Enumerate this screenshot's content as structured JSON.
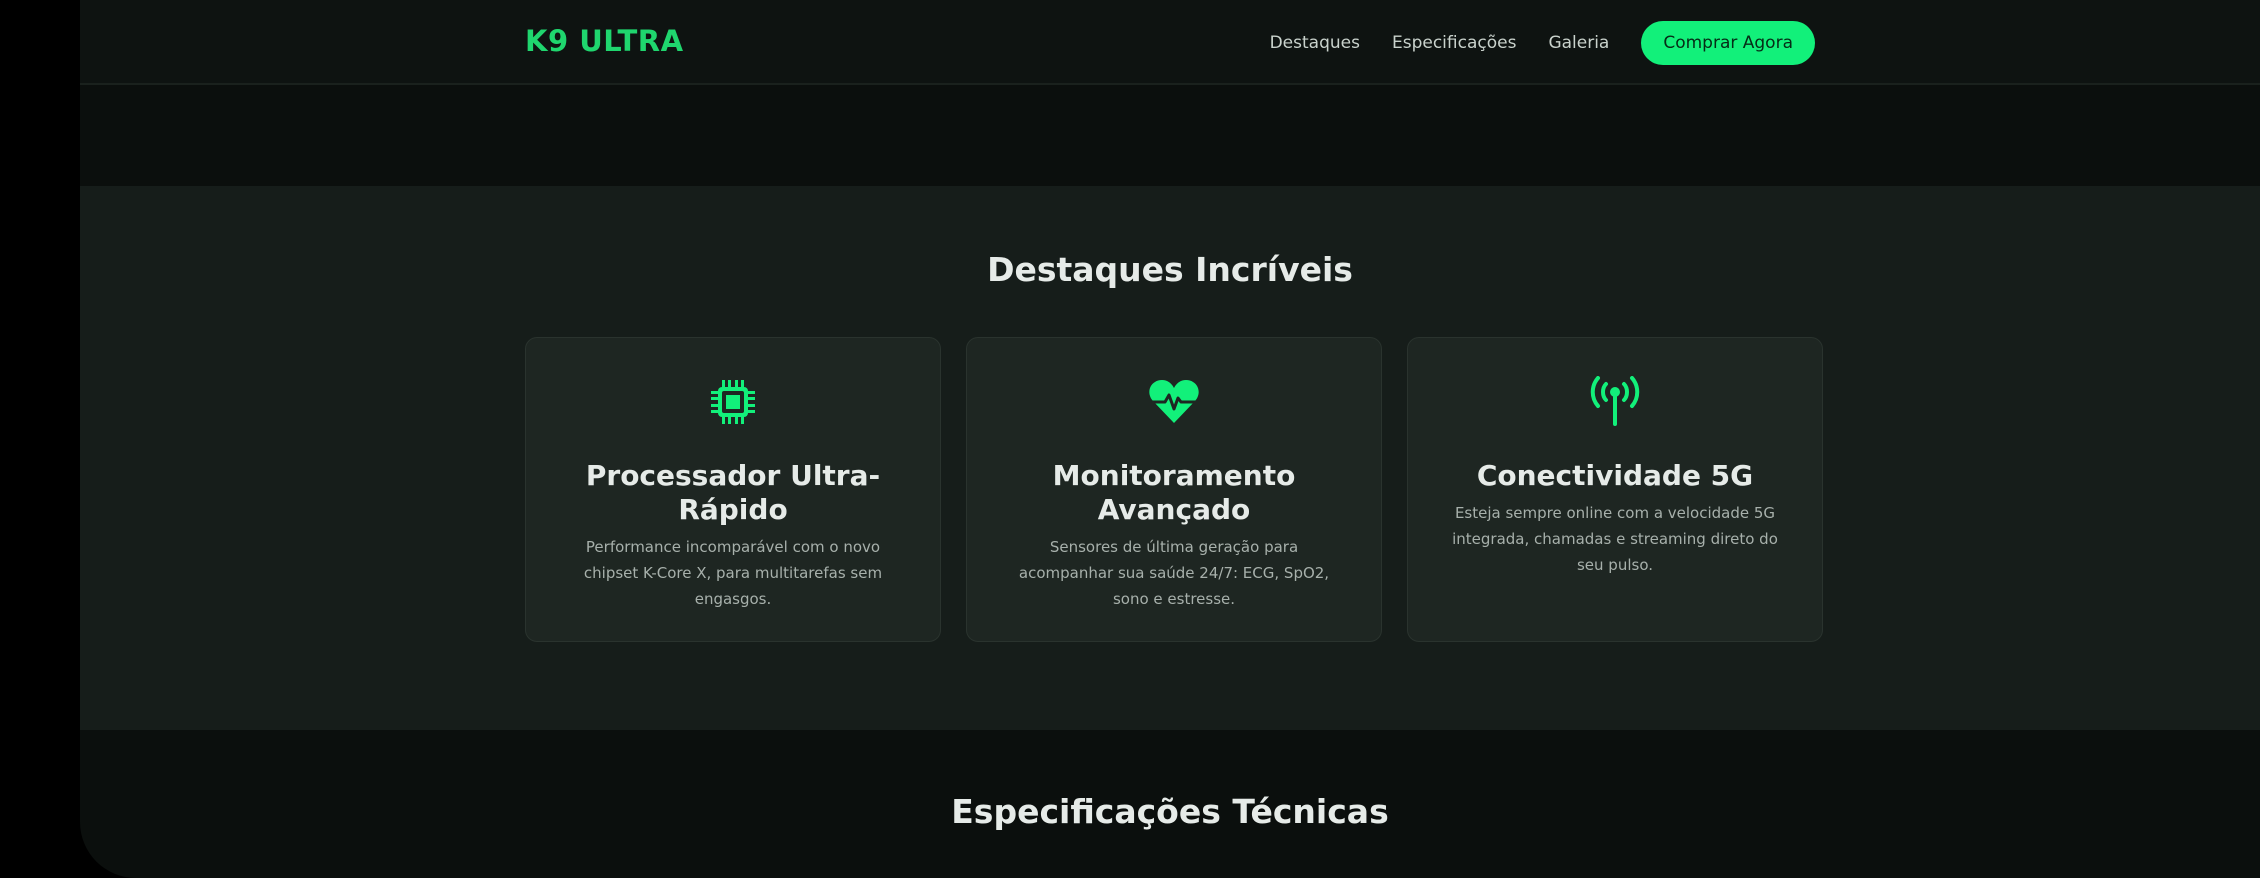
{
  "header": {
    "brand": "K9 ULTRA",
    "nav": [
      "Destaques",
      "Especificações",
      "Galeria"
    ],
    "cta": "Comprar Agora"
  },
  "features": {
    "title": "Destaques Incríveis",
    "cards": [
      {
        "icon": "chip-icon",
        "title": "Processador Ultra-Rápido",
        "description": "Performance incomparável com o novo chipset K-Core X, para multitarefas sem engasgos."
      },
      {
        "icon": "heart-pulse-icon",
        "title": "Monitoramento Avançado",
        "description": "Sensores de última geração para acompanhar sua saúde 24/7: ECG, SpO2, sono e estresse."
      },
      {
        "icon": "antenna-icon",
        "title": "Conectividade 5G",
        "description": "Esteja sempre online com a velocidade 5G integrada, chamadas e streaming direto do seu pulso."
      }
    ]
  },
  "specs": {
    "title": "Especificações Técnicas"
  },
  "colors": {
    "accent": "#12f07a",
    "brand": "#1fd66e",
    "background": "#0b0f0d",
    "section": "#161d1a",
    "card": "#1e2622"
  }
}
